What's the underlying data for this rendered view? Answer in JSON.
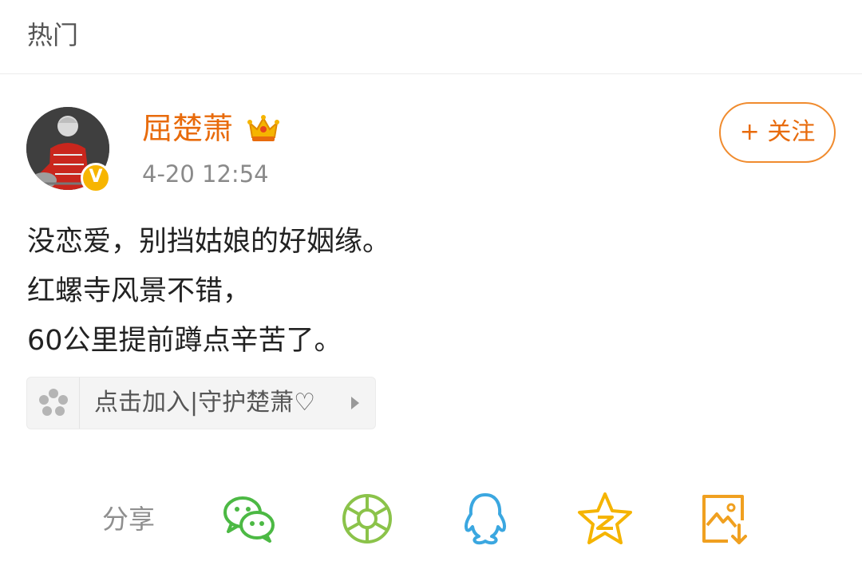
{
  "header": {
    "title": "热门"
  },
  "post": {
    "author": "屈楚萧",
    "time": "4-20 12:54",
    "verified_mark": "V",
    "follow_label": "+ 关注",
    "lines": [
      "没恋爱，别挡姑娘的好姻缘。",
      "红螺寺风景不错，",
      "60公里提前蹲点辛苦了。"
    ],
    "superchat_label": "点击加入|守护楚萧♡"
  },
  "share": {
    "label": "分享",
    "targets": [
      {
        "name": "wechat-icon",
        "color": "#4cb944"
      },
      {
        "name": "wechat-moments-icon",
        "color": "#8bc34a"
      },
      {
        "name": "qq-icon",
        "color": "#3ba7e0"
      },
      {
        "name": "qzone-icon",
        "color": "#f5b400"
      },
      {
        "name": "save-image-icon",
        "color": "#f0a020"
      }
    ]
  },
  "colors": {
    "accent": "#e86b0c",
    "badge": "#f7b500"
  }
}
